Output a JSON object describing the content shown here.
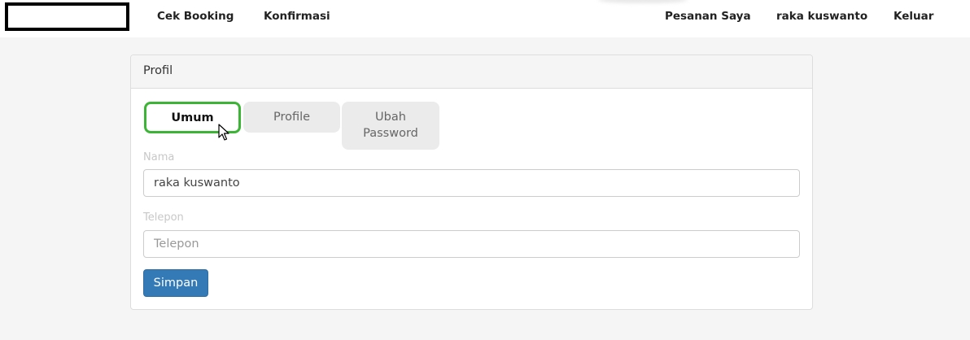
{
  "navbar": {
    "links_left": [
      "Cek Booking",
      "Konfirmasi"
    ],
    "links_right": [
      "Pesanan Saya",
      "raka kuswanto",
      "Keluar"
    ]
  },
  "panel": {
    "title": "Profil",
    "tabs": [
      {
        "label": "Umum",
        "active": true
      },
      {
        "label": "Profile",
        "active": false
      },
      {
        "label": "Ubah\nPassword",
        "active": false
      }
    ]
  },
  "form": {
    "nama_label": "Nama",
    "nama_value": "raka kuswanto",
    "telepon_label": "Telepon",
    "telepon_placeholder": "Telepon",
    "submit_label": "Simpan"
  },
  "colors": {
    "active_tab_border": "#3cb536",
    "primary_button": "#337ab7"
  }
}
